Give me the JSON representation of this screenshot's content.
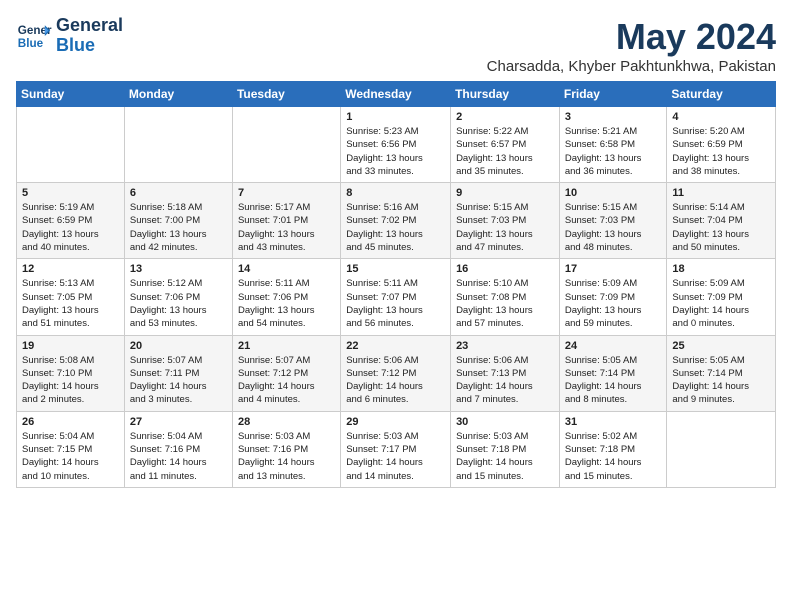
{
  "header": {
    "logo_line1": "General",
    "logo_line2": "Blue",
    "month": "May 2024",
    "location": "Charsadda, Khyber Pakhtunkhwa, Pakistan"
  },
  "days_of_week": [
    "Sunday",
    "Monday",
    "Tuesday",
    "Wednesday",
    "Thursday",
    "Friday",
    "Saturday"
  ],
  "weeks": [
    [
      {
        "day": "",
        "info": ""
      },
      {
        "day": "",
        "info": ""
      },
      {
        "day": "",
        "info": ""
      },
      {
        "day": "1",
        "info": "Sunrise: 5:23 AM\nSunset: 6:56 PM\nDaylight: 13 hours\nand 33 minutes."
      },
      {
        "day": "2",
        "info": "Sunrise: 5:22 AM\nSunset: 6:57 PM\nDaylight: 13 hours\nand 35 minutes."
      },
      {
        "day": "3",
        "info": "Sunrise: 5:21 AM\nSunset: 6:58 PM\nDaylight: 13 hours\nand 36 minutes."
      },
      {
        "day": "4",
        "info": "Sunrise: 5:20 AM\nSunset: 6:59 PM\nDaylight: 13 hours\nand 38 minutes."
      }
    ],
    [
      {
        "day": "5",
        "info": "Sunrise: 5:19 AM\nSunset: 6:59 PM\nDaylight: 13 hours\nand 40 minutes."
      },
      {
        "day": "6",
        "info": "Sunrise: 5:18 AM\nSunset: 7:00 PM\nDaylight: 13 hours\nand 42 minutes."
      },
      {
        "day": "7",
        "info": "Sunrise: 5:17 AM\nSunset: 7:01 PM\nDaylight: 13 hours\nand 43 minutes."
      },
      {
        "day": "8",
        "info": "Sunrise: 5:16 AM\nSunset: 7:02 PM\nDaylight: 13 hours\nand 45 minutes."
      },
      {
        "day": "9",
        "info": "Sunrise: 5:15 AM\nSunset: 7:03 PM\nDaylight: 13 hours\nand 47 minutes."
      },
      {
        "day": "10",
        "info": "Sunrise: 5:15 AM\nSunset: 7:03 PM\nDaylight: 13 hours\nand 48 minutes."
      },
      {
        "day": "11",
        "info": "Sunrise: 5:14 AM\nSunset: 7:04 PM\nDaylight: 13 hours\nand 50 minutes."
      }
    ],
    [
      {
        "day": "12",
        "info": "Sunrise: 5:13 AM\nSunset: 7:05 PM\nDaylight: 13 hours\nand 51 minutes."
      },
      {
        "day": "13",
        "info": "Sunrise: 5:12 AM\nSunset: 7:06 PM\nDaylight: 13 hours\nand 53 minutes."
      },
      {
        "day": "14",
        "info": "Sunrise: 5:11 AM\nSunset: 7:06 PM\nDaylight: 13 hours\nand 54 minutes."
      },
      {
        "day": "15",
        "info": "Sunrise: 5:11 AM\nSunset: 7:07 PM\nDaylight: 13 hours\nand 56 minutes."
      },
      {
        "day": "16",
        "info": "Sunrise: 5:10 AM\nSunset: 7:08 PM\nDaylight: 13 hours\nand 57 minutes."
      },
      {
        "day": "17",
        "info": "Sunrise: 5:09 AM\nSunset: 7:09 PM\nDaylight: 13 hours\nand 59 minutes."
      },
      {
        "day": "18",
        "info": "Sunrise: 5:09 AM\nSunset: 7:09 PM\nDaylight: 14 hours\nand 0 minutes."
      }
    ],
    [
      {
        "day": "19",
        "info": "Sunrise: 5:08 AM\nSunset: 7:10 PM\nDaylight: 14 hours\nand 2 minutes."
      },
      {
        "day": "20",
        "info": "Sunrise: 5:07 AM\nSunset: 7:11 PM\nDaylight: 14 hours\nand 3 minutes."
      },
      {
        "day": "21",
        "info": "Sunrise: 5:07 AM\nSunset: 7:12 PM\nDaylight: 14 hours\nand 4 minutes."
      },
      {
        "day": "22",
        "info": "Sunrise: 5:06 AM\nSunset: 7:12 PM\nDaylight: 14 hours\nand 6 minutes."
      },
      {
        "day": "23",
        "info": "Sunrise: 5:06 AM\nSunset: 7:13 PM\nDaylight: 14 hours\nand 7 minutes."
      },
      {
        "day": "24",
        "info": "Sunrise: 5:05 AM\nSunset: 7:14 PM\nDaylight: 14 hours\nand 8 minutes."
      },
      {
        "day": "25",
        "info": "Sunrise: 5:05 AM\nSunset: 7:14 PM\nDaylight: 14 hours\nand 9 minutes."
      }
    ],
    [
      {
        "day": "26",
        "info": "Sunrise: 5:04 AM\nSunset: 7:15 PM\nDaylight: 14 hours\nand 10 minutes."
      },
      {
        "day": "27",
        "info": "Sunrise: 5:04 AM\nSunset: 7:16 PM\nDaylight: 14 hours\nand 11 minutes."
      },
      {
        "day": "28",
        "info": "Sunrise: 5:03 AM\nSunset: 7:16 PM\nDaylight: 14 hours\nand 13 minutes."
      },
      {
        "day": "29",
        "info": "Sunrise: 5:03 AM\nSunset: 7:17 PM\nDaylight: 14 hours\nand 14 minutes."
      },
      {
        "day": "30",
        "info": "Sunrise: 5:03 AM\nSunset: 7:18 PM\nDaylight: 14 hours\nand 15 minutes."
      },
      {
        "day": "31",
        "info": "Sunrise: 5:02 AM\nSunset: 7:18 PM\nDaylight: 14 hours\nand 15 minutes."
      },
      {
        "day": "",
        "info": ""
      }
    ]
  ]
}
